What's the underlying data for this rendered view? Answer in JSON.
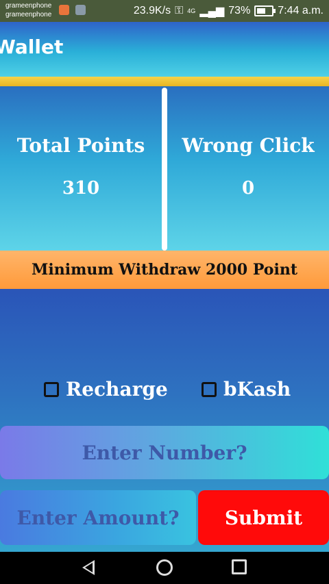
{
  "status_bar": {
    "carrier_line1": "grameenphone",
    "carrier_line2": "grameenphone",
    "speed": "23.9K/s",
    "network": "4G",
    "battery": "73%",
    "time": "7:44 a.m."
  },
  "header": {
    "title": "Wallet"
  },
  "stats": {
    "total_points_label": "Total Points",
    "total_points_value": "310",
    "wrong_click_label": "Wrong Click",
    "wrong_click_value": "0"
  },
  "banner": {
    "text": "Minimum Withdraw 2000 Point"
  },
  "options": {
    "recharge_label": "Recharge",
    "bkash_label": "bKash"
  },
  "form": {
    "number_placeholder": "Enter Number?",
    "amount_placeholder": "Enter Amount?",
    "submit_label": "Submit"
  },
  "colors": {
    "accent_gold": "#f7d34a",
    "banner_orange": "#ff9a3a",
    "submit_red": "#ff0a0a"
  }
}
